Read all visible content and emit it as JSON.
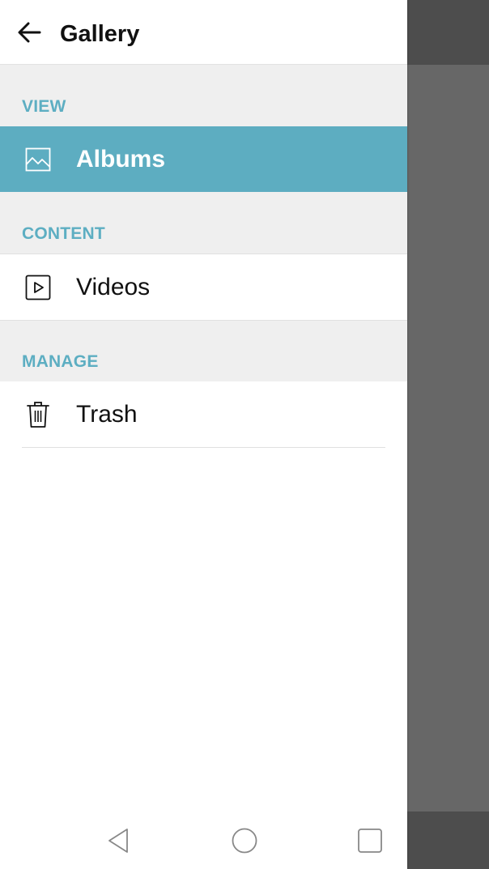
{
  "header": {
    "title": "Gallery",
    "back_icon": "arrow-left-icon"
  },
  "sections": {
    "view": {
      "label": "VIEW",
      "items": [
        {
          "label": "Albums",
          "icon": "image-icon",
          "selected": true
        }
      ]
    },
    "content": {
      "label": "CONTENT",
      "items": [
        {
          "label": "Videos",
          "icon": "play-box-icon",
          "selected": false
        }
      ]
    },
    "manage": {
      "label": "MANAGE",
      "items": [
        {
          "label": "Trash",
          "icon": "trash-icon",
          "selected": false
        }
      ]
    }
  },
  "navbar": {
    "buttons": [
      "back-triangle-icon",
      "home-circle-icon",
      "recents-square-icon"
    ]
  },
  "colors": {
    "accent": "#5dadc1",
    "section_label": "#5daec2",
    "section_bg": "#efefef",
    "scrim": "#676767"
  }
}
